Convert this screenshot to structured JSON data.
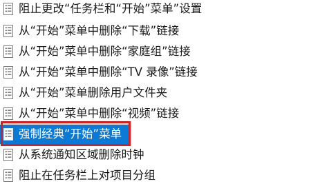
{
  "policy_list": {
    "items": [
      {
        "label": "阻止更改“任务栏和“开始”菜单”设置",
        "icon": "policy-setting-icon",
        "selected": false
      },
      {
        "label": "从“开始”菜单中删除“下载”链接",
        "icon": "policy-setting-icon",
        "selected": false
      },
      {
        "label": "从“开始”菜单中删除“家庭组”链接",
        "icon": "policy-setting-icon",
        "selected": false
      },
      {
        "label": "从“开始”菜单中删除“TV 录像”链接",
        "icon": "policy-setting-icon",
        "selected": false
      },
      {
        "label": "从“开始”菜单删除用户文件夹",
        "icon": "policy-setting-icon",
        "selected": false
      },
      {
        "label": "从“开始”菜单中删除“视频”链接",
        "icon": "policy-setting-icon",
        "selected": false
      },
      {
        "label": "强制经典“开始”菜单",
        "icon": "policy-setting-icon",
        "selected": true
      },
      {
        "label": "从系统通知区域删除时钟",
        "icon": "policy-setting-icon",
        "selected": false
      },
      {
        "label": "阻止在任务栏上对项目分组",
        "icon": "policy-setting-icon",
        "selected": false
      }
    ]
  },
  "colors": {
    "selection": "#0a7ad6",
    "highlight_border": "#e01b1b",
    "text": "#1a1a1a"
  }
}
